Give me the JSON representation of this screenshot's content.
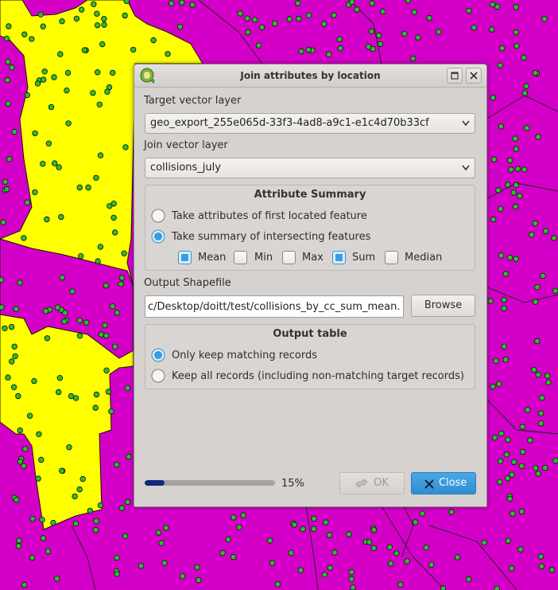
{
  "colors": {
    "map_magenta": "#d400c8",
    "map_yellow": "#ffff00",
    "point_green": "#2fbb2f",
    "accent_blue": "#3a9cdc",
    "progress_fill": "#102a7a"
  },
  "dialog": {
    "title": "Join attributes by location",
    "app_icon": "qgis-icon",
    "maximize_icon": "maximize-icon",
    "close_icon": "close-icon"
  },
  "target_layer": {
    "label": "Target vector layer",
    "value": "geo_export_255e065d-33f3-4ad8-a9c1-e1c4d70b33cf"
  },
  "join_layer": {
    "label": "Join vector layer",
    "value": "collisions_july"
  },
  "attribute_summary": {
    "title": "Attribute Summary",
    "options": [
      {
        "label": "Take attributes of first located feature",
        "checked": false
      },
      {
        "label": "Take summary of intersecting features",
        "checked": true
      }
    ],
    "stats": [
      {
        "label": "Mean",
        "checked": true
      },
      {
        "label": "Min",
        "checked": false
      },
      {
        "label": "Max",
        "checked": false
      },
      {
        "label": "Sum",
        "checked": true
      },
      {
        "label": "Median",
        "checked": false
      }
    ]
  },
  "output_shapefile": {
    "label": "Output Shapefile",
    "value": "c/Desktop/doitt/test/collisions_by_cc_sum_mean.shp",
    "browse_label": "Browse"
  },
  "output_table": {
    "title": "Output table",
    "options": [
      {
        "label": "Only keep matching records",
        "checked": true
      },
      {
        "label": "Keep all records (including non-matching target records)",
        "checked": false
      }
    ]
  },
  "progress": {
    "value": 0.15,
    "text": "15%"
  },
  "buttons": {
    "ok_label": "OK",
    "ok_icon": "ok-icon",
    "close_label": "Close",
    "close_icon": "close-x-icon"
  }
}
